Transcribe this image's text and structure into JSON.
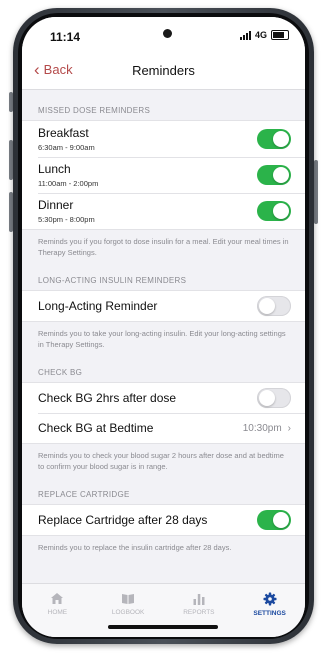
{
  "status": {
    "time": "11:14",
    "network": "4G"
  },
  "nav": {
    "back_label": "Back",
    "title": "Reminders"
  },
  "missed_dose": {
    "header": "MISSED DOSE REMINDERS",
    "items": [
      {
        "label": "Breakfast",
        "time": "6:30am - 9:00am",
        "enabled": true
      },
      {
        "label": "Lunch",
        "time": "11:00am - 2:00pm",
        "enabled": true
      },
      {
        "label": "Dinner",
        "time": "5:30pm - 8:00pm",
        "enabled": true
      }
    ],
    "footnote": "Reminds you if you forgot to dose insulin for a meal. Edit your meal times in Therapy Settings."
  },
  "long_acting": {
    "header": "LONG-ACTING INSULIN REMINDERS",
    "item": {
      "label": "Long-Acting Reminder",
      "enabled": false
    },
    "footnote": "Reminds you to take your long-acting insulin. Edit your long-acting settings in Therapy Settings."
  },
  "check_bg": {
    "header": "CHECK BG",
    "after_dose": {
      "label": "Check BG 2hrs after dose",
      "enabled": false
    },
    "bedtime": {
      "label": "Check BG at Bedtime",
      "value": "10:30pm"
    },
    "footnote": "Reminds you to check your blood sugar 2 hours after dose and at bedtime to confirm your blood sugar is in range."
  },
  "replace_cartridge": {
    "header": "REPLACE CARTRIDGE",
    "item": {
      "label": "Replace Cartridge after 28 days",
      "enabled": true
    },
    "footnote": "Reminds you to replace the insulin cartridge after 28 days."
  },
  "tabs": [
    {
      "label": "HOME",
      "icon": "home-icon",
      "active": false
    },
    {
      "label": "LOGBOOK",
      "icon": "book-icon",
      "active": false
    },
    {
      "label": "REPORTS",
      "icon": "bar-chart-icon",
      "active": false
    },
    {
      "label": "SETTINGS",
      "icon": "gear-icon",
      "active": true
    }
  ],
  "colors": {
    "toggle_on": "#2bb34a",
    "back_link": "#b44a4a",
    "active_tab": "#1c4aa0"
  }
}
